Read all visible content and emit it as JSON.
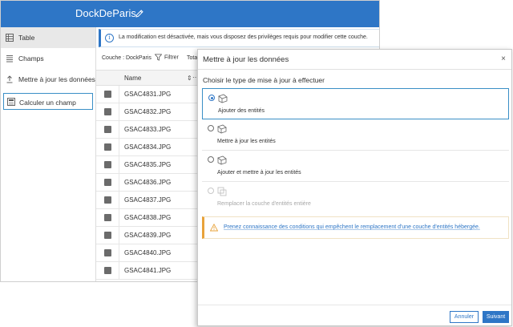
{
  "app": {
    "title": "DockDeParis",
    "accent_color": "#2e76c6"
  },
  "sidebar": {
    "items": [
      {
        "label": "Table",
        "icon": "table-icon",
        "selected": true
      },
      {
        "label": "Champs",
        "icon": "fields-icon"
      },
      {
        "label": "Mettre à jour les données",
        "icon": "update-data-icon"
      },
      {
        "label": "Calculer un champ",
        "icon": "calculator-icon"
      }
    ]
  },
  "info": {
    "icon": "info-icon",
    "text": "La modification est désactivée, mais vous disposez des privilèges requis pour modifier cette couche."
  },
  "toolbar": {
    "layer_label": "Couche : DockParis",
    "filter_label": "Filtrer",
    "total_label": "Total"
  },
  "grid": {
    "column_name": "Name",
    "sort_icon": "sort-icon",
    "more_icon": "more-icon",
    "rows": [
      "GSAC4831.JPG",
      "GSAC4832.JPG",
      "GSAC4833.JPG",
      "GSAC4834.JPG",
      "GSAC4835.JPG",
      "GSAC4836.JPG",
      "GSAC4837.JPG",
      "GSAC4838.JPG",
      "GSAC4839.JPG",
      "GSAC4840.JPG",
      "GSAC4841.JPG"
    ]
  },
  "modal": {
    "title": "Mettre à jour les données",
    "close": "×",
    "subtitle": "Choisir le type de mise à jour à effectuer",
    "options": [
      {
        "label": "Ajouter des entités",
        "selected": true,
        "disabled": false,
        "icon": "add-features-icon"
      },
      {
        "label": "Mettre à jour les entités",
        "selected": false,
        "disabled": false,
        "icon": "update-features-icon"
      },
      {
        "label": "Ajouter et mettre à jour les entités",
        "selected": false,
        "disabled": false,
        "icon": "add-update-features-icon"
      },
      {
        "label": "Remplacer la couche d'entités entière",
        "selected": false,
        "disabled": true,
        "icon": "replace-layer-icon"
      }
    ],
    "warning": {
      "icon": "warning-icon",
      "text": "Prenez connaissance des conditions qui empêchent le remplacement d'une couche d'entités hébergée."
    },
    "cancel_label": "Annuler",
    "next_label": "Suivant"
  }
}
